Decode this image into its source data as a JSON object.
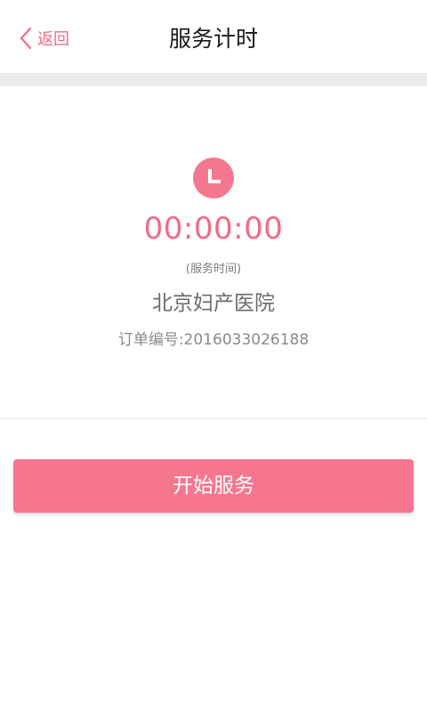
{
  "header": {
    "back_label": "返回",
    "title": "服务计时"
  },
  "timer": {
    "elapsed": "00:00:00",
    "caption": "(服务时间)",
    "hospital": "北京妇产医院",
    "order_number": "订单编号:2016033026188"
  },
  "actions": {
    "start_label": "开始服务"
  },
  "colors": {
    "accent": "#f06b86",
    "button": "#f7768f",
    "separator": "#ebebeb"
  },
  "icons": {
    "back": "chevron-left-icon",
    "timer": "clock-icon"
  }
}
